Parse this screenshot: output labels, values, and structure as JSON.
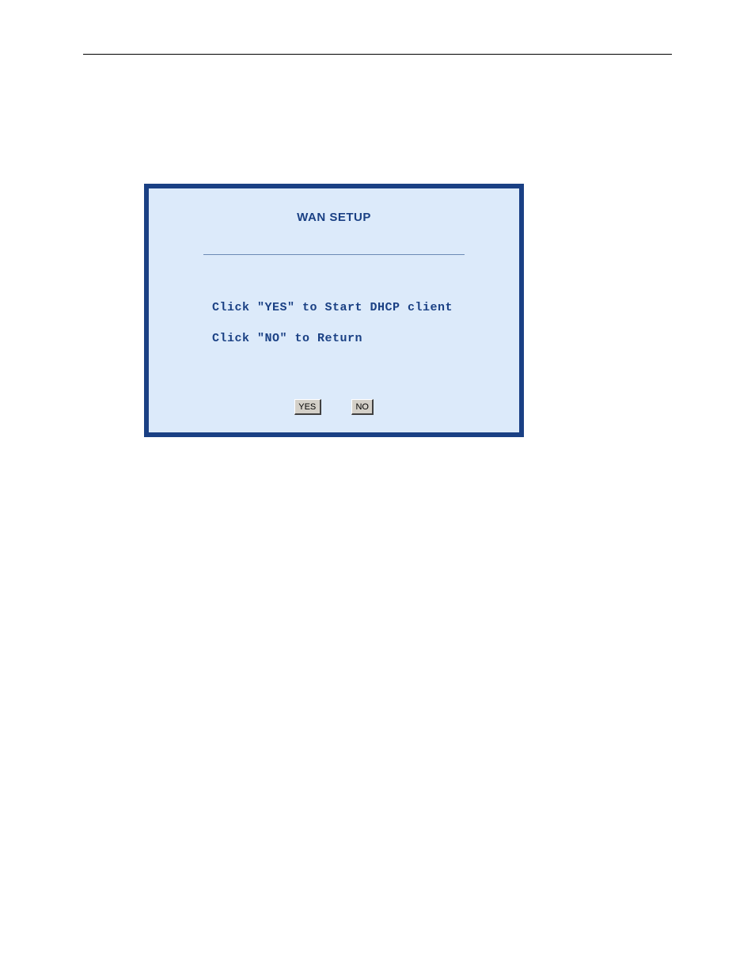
{
  "dialog": {
    "title": "WAN SETUP",
    "line1": "Click \"YES\" to Start DHCP client",
    "line2": "Click \"NO\" to Return",
    "yes_label": "YES",
    "no_label": "NO"
  }
}
